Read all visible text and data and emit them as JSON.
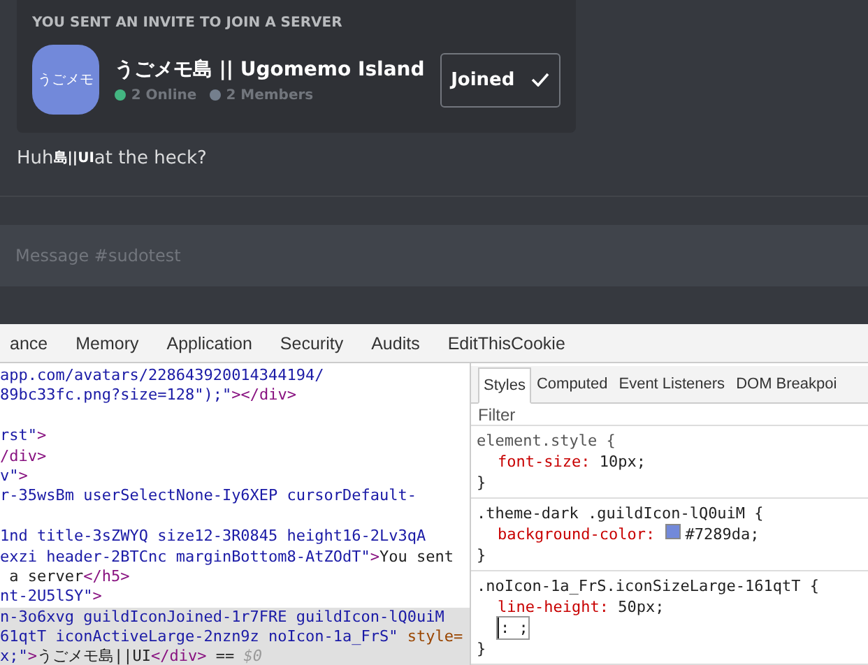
{
  "invite": {
    "header": "YOU SENT AN INVITE TO JOIN A SERVER",
    "icon_text": "うごメモ",
    "name": "うごメモ島 || Ugomemo Island",
    "stats": [
      {
        "label": "2 Online",
        "color": "#43b581"
      },
      {
        "label": "2 Members",
        "color": "#747f8d"
      }
    ],
    "button": "Joined"
  },
  "message": {
    "before": "Huh",
    "overlay": "島||UI",
    "after": "at the heck?"
  },
  "composer": {
    "placeholder": "Message #sudotest"
  },
  "devtools": {
    "tabs": [
      {
        "label": "ance",
        "selected": false
      },
      {
        "label": "Memory",
        "selected": false
      },
      {
        "label": "Application",
        "selected": false
      },
      {
        "label": "Security",
        "selected": false
      },
      {
        "label": "Audits",
        "selected": false
      },
      {
        "label": "EditThisCookie",
        "selected": false
      }
    ],
    "code_lines": [
      {
        "selected": false,
        "segments": [
          {
            "kind": "value",
            "text": "app.com/avatars/228643920014344194/"
          }
        ]
      },
      {
        "selected": false,
        "segments": [
          {
            "kind": "value",
            "text": "89bc33fc.png?size=128\");\""
          },
          {
            "kind": "tag",
            "text": "></div>"
          }
        ]
      },
      {
        "selected": false
      },
      {
        "selected": false,
        "segments": [
          {
            "kind": "value",
            "text": "rst\""
          },
          {
            "kind": "tag",
            "text": ">"
          }
        ]
      },
      {
        "selected": false,
        "segments": [
          {
            "kind": "tag",
            "text": "/div>"
          }
        ]
      },
      {
        "selected": false,
        "segments": [
          {
            "kind": "value",
            "text": "v\""
          },
          {
            "kind": "tag",
            "text": ">"
          }
        ]
      },
      {
        "selected": false,
        "segments": [
          {
            "kind": "value",
            "text": "r-35wsBm userSelectNone-Iy6XEP cursorDefault-"
          }
        ]
      },
      {
        "selected": false
      },
      {
        "selected": false,
        "segments": [
          {
            "kind": "value",
            "text": "1nd title-3sZWYQ size12-3R0845 height16-2Lv3qA"
          }
        ]
      },
      {
        "selected": false,
        "segments": [
          {
            "kind": "value",
            "text": "exzi header-2BTCnc marginBottom8-AtZOdT\""
          },
          {
            "kind": "tag",
            "text": ">"
          },
          {
            "kind": "text",
            "text": "You sent"
          }
        ]
      },
      {
        "selected": false,
        "segments": [
          {
            "kind": "text",
            "text": " a server"
          },
          {
            "kind": "tag",
            "text": "</h5>"
          }
        ]
      },
      {
        "selected": false,
        "segments": [
          {
            "kind": "value",
            "text": "nt-2U5lSY\""
          },
          {
            "kind": "tag",
            "text": ">"
          }
        ]
      },
      {
        "selected": true,
        "segments": [
          {
            "kind": "value",
            "text": "n-3o6xvg guildIconJoined-1r7FRE guildIcon-lQ0uiM"
          }
        ]
      },
      {
        "selected": true,
        "segments": [
          {
            "kind": "value",
            "text": "61qtT iconActiveLarge-2nzn9z noIcon-1a_FrS\""
          },
          {
            "kind": "attr",
            "text": " style="
          }
        ]
      },
      {
        "selected": true,
        "segments": [
          {
            "kind": "value",
            "text": "x;\""
          },
          {
            "kind": "tag",
            "text": ">"
          },
          {
            "kind": "text",
            "text": "うごメモ島||UI"
          },
          {
            "kind": "tag",
            "text": "</div>"
          },
          {
            "kind": "text",
            "text": " == "
          },
          {
            "kind": "dim",
            "text": "$0"
          }
        ]
      }
    ],
    "side_tabs": [
      {
        "label": "Styles",
        "selected": true
      },
      {
        "label": "Computed",
        "selected": false
      },
      {
        "label": "Event Listeners",
        "selected": false
      },
      {
        "label": "DOM Breakpoi",
        "selected": false
      }
    ],
    "filter": {
      "placeholder": "Filter"
    },
    "rules": [
      {
        "selector": "element.style {",
        "props": [
          {
            "name": "font-size:",
            "value": "10px;"
          }
        ],
        "close": "}"
      },
      {
        "selector": ".theme-dark .guildIcon-lQ0uiM {",
        "props": [
          {
            "name": "background-color:",
            "value": "#7289da;",
            "color": "#7289da"
          }
        ],
        "close": "}"
      },
      {
        "selector": ".noIcon-1a_FrS.iconSizeLarge-161qtT {",
        "props": [
          {
            "name": "line-height:",
            "value": "50px;"
          },
          {
            "editing": true,
            "value": ": ;"
          }
        ],
        "close": "}"
      }
    ]
  }
}
